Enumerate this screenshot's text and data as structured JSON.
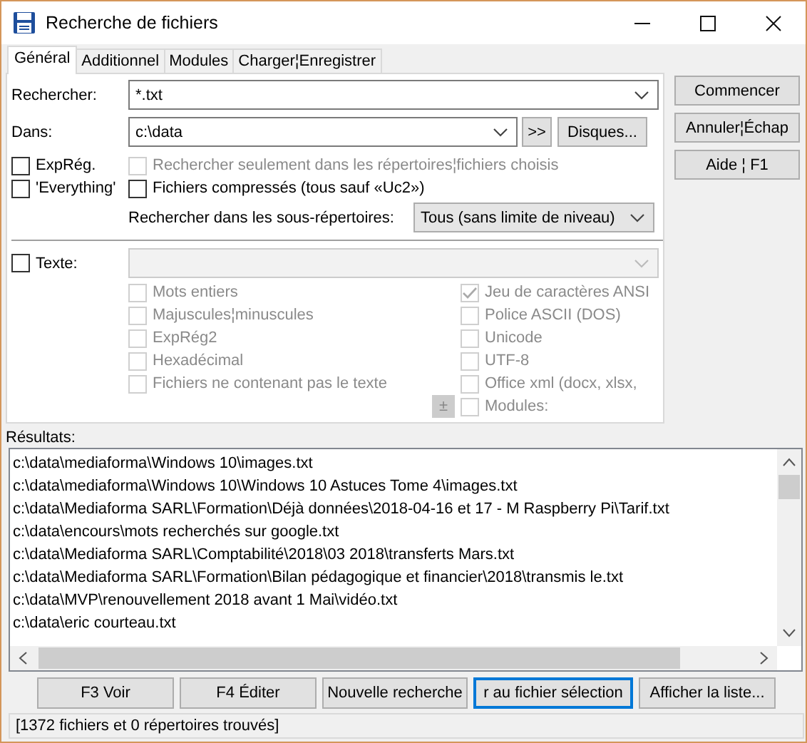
{
  "window": {
    "title": "Recherche de fichiers"
  },
  "tabs": [
    {
      "label": "Général",
      "selected": true
    },
    {
      "label": "Additionnel",
      "selected": false
    },
    {
      "label": "Modules",
      "selected": false
    },
    {
      "label": "Charger¦Enregistrer",
      "selected": false
    }
  ],
  "search": {
    "fields": [
      {
        "label": "Rechercher:",
        "value": "*.txt"
      },
      {
        "label": "Dans:",
        "value": "c:\\data"
      }
    ],
    "browse_button": ">>",
    "drives_button": "Disques...",
    "options_left": [
      {
        "label": "ExpRég.",
        "checked": false
      },
      {
        "label": "'Everything'",
        "checked": false
      }
    ],
    "options_right": [
      {
        "label": "Rechercher seulement dans les répertoires¦fichiers choisis",
        "checked": false,
        "disabled": true
      },
      {
        "label": "Fichiers compressés (tous sauf «Uc2»)",
        "checked": false,
        "disabled": false
      }
    ],
    "subdirs": {
      "label": "Rechercher dans les sous-répertoires:",
      "value": "Tous (sans limite de niveau)"
    }
  },
  "text_search": {
    "label": "Texte:",
    "checked": false,
    "field_disabled": true,
    "expand_button": "±",
    "options_left": [
      {
        "label": "Mots entiers",
        "checked": false,
        "disabled": true
      },
      {
        "label": "Majuscules¦minuscules",
        "checked": false,
        "disabled": true
      },
      {
        "label": "ExpRég2",
        "checked": false,
        "disabled": true
      },
      {
        "label": "Hexadécimal",
        "checked": false,
        "disabled": true
      },
      {
        "label": "Fichiers ne contenant pas le texte",
        "checked": false,
        "disabled": true
      }
    ],
    "options_right": [
      {
        "label": "Jeu de caractères ANSI",
        "checked": true,
        "disabled": true
      },
      {
        "label": "Police ASCII (DOS)",
        "checked": false,
        "disabled": true
      },
      {
        "label": "Unicode",
        "checked": false,
        "disabled": true
      },
      {
        "label": "UTF-8",
        "checked": false,
        "disabled": true
      },
      {
        "label": "Office xml (docx, xlsx,",
        "checked": false,
        "disabled": true
      },
      {
        "label": "Modules:",
        "checked": false,
        "disabled": true
      }
    ]
  },
  "action_buttons": [
    "Commencer",
    "Annuler¦Échap",
    "Aide ¦ F1"
  ],
  "results": {
    "label": "Résultats:",
    "rows": [
      "c:\\data\\mediaforma\\Windows 10\\images.txt",
      "c:\\data\\mediaforma\\Windows 10\\Windows 10 Astuces Tome 4\\images.txt",
      "c:\\data\\Mediaforma SARL\\Formation\\Déjà données\\2018-04-16 et 17 - M Raspberry Pi\\Tarif.txt",
      "c:\\data\\encours\\mots recherchés sur google.txt",
      "c:\\data\\Mediaforma SARL\\Comptabilité\\2018\\03 2018\\transferts Mars.txt",
      "c:\\data\\Mediaforma SARL\\Formation\\Bilan pédagogique et financier\\2018\\transmis le.txt",
      "c:\\data\\MVP\\renouvellement 2018 avant 1 Mai\\vidéo.txt",
      "c:\\data\\eric courteau.txt"
    ]
  },
  "bottom_buttons": [
    {
      "label": "F3 Voir",
      "focused": false
    },
    {
      "label": "F4 Éditer",
      "focused": false
    },
    {
      "label": "Nouvelle recherche",
      "focused": false
    },
    {
      "label": "r au fichier sélection",
      "focused": true
    },
    {
      "label": "Afficher la liste...",
      "focused": false
    }
  ],
  "status_bar": "[1372 fichiers et 0 répertoires trouvés]"
}
